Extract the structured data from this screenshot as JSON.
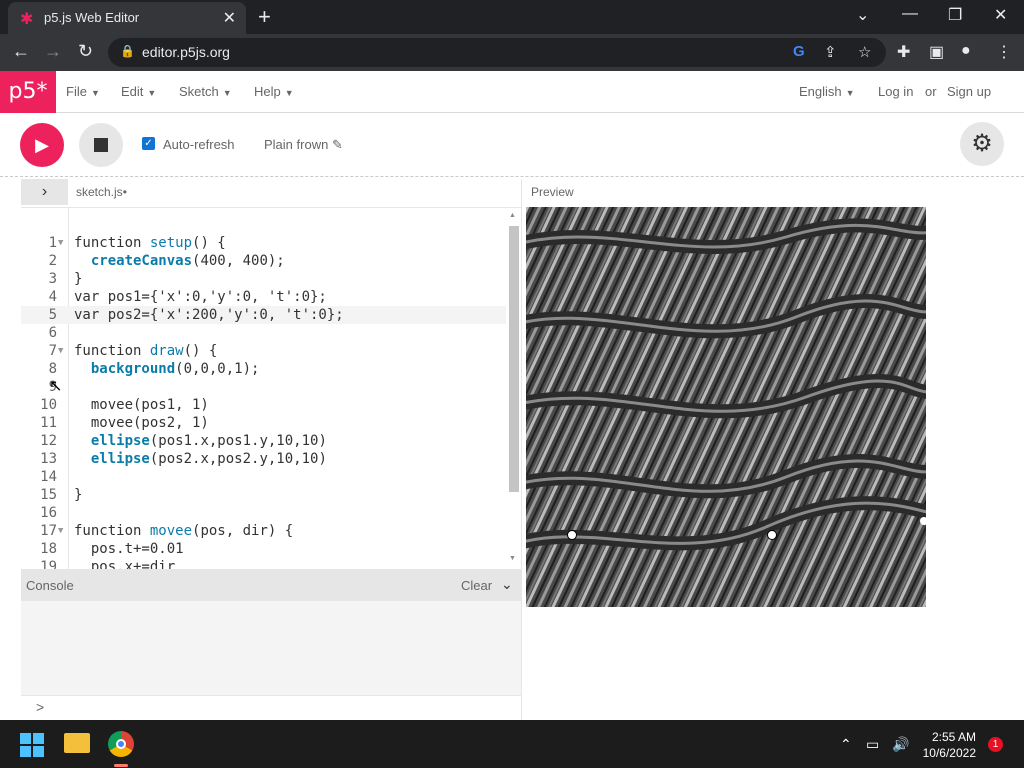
{
  "browser": {
    "tab_title": "p5.js Web Editor",
    "url": "editor.p5js.org"
  },
  "nav": {
    "logo": "p5*",
    "menus": [
      "File",
      "Edit",
      "Sketch",
      "Help"
    ],
    "language": "English",
    "login": "Log in",
    "or": "or",
    "signup": "Sign up"
  },
  "toolbar": {
    "auto_refresh_label": "Auto-refresh",
    "auto_refresh_checked": true,
    "project_name": "Plain frown"
  },
  "editor": {
    "file_name": "sketch.js",
    "unsaved": true,
    "preview_label": "Preview",
    "lines": [
      {
        "n": "1",
        "fold": true,
        "code": "function setup() {"
      },
      {
        "n": "2",
        "code": "  createCanvas(400, 400);"
      },
      {
        "n": "3",
        "code": "}"
      },
      {
        "n": "4",
        "code": "var pos1={'x':0,'y':0, 't':0};"
      },
      {
        "n": "5",
        "code": "var pos2={'x':200,'y':0, 't':0};",
        "active": true
      },
      {
        "n": "6",
        "code": ""
      },
      {
        "n": "7",
        "fold": true,
        "code": "function draw() {"
      },
      {
        "n": "8",
        "code": "  background(0,0,0,1);"
      },
      {
        "n": "9",
        "code": ""
      },
      {
        "n": "10",
        "code": "  movee(pos1, 1)"
      },
      {
        "n": "11",
        "code": "  movee(pos2, 1)"
      },
      {
        "n": "12",
        "code": "  ellipse(pos1.x,pos1.y,10,10)"
      },
      {
        "n": "13",
        "code": "  ellipse(pos2.x,pos2.y,10,10)"
      },
      {
        "n": "14",
        "code": ""
      },
      {
        "n": "15",
        "code": "}"
      },
      {
        "n": "16",
        "code": ""
      },
      {
        "n": "17",
        "fold": true,
        "code": "function movee(pos, dir) {"
      },
      {
        "n": "18",
        "code": "  pos.t+=0.01"
      },
      {
        "n": "19",
        "code": "  pos.x+=dir"
      }
    ]
  },
  "console": {
    "label": "Console",
    "clear": "Clear",
    "prompt": ">"
  },
  "taskbar": {
    "time": "2:55 AM",
    "date": "10/6/2022",
    "notifications": "1"
  }
}
